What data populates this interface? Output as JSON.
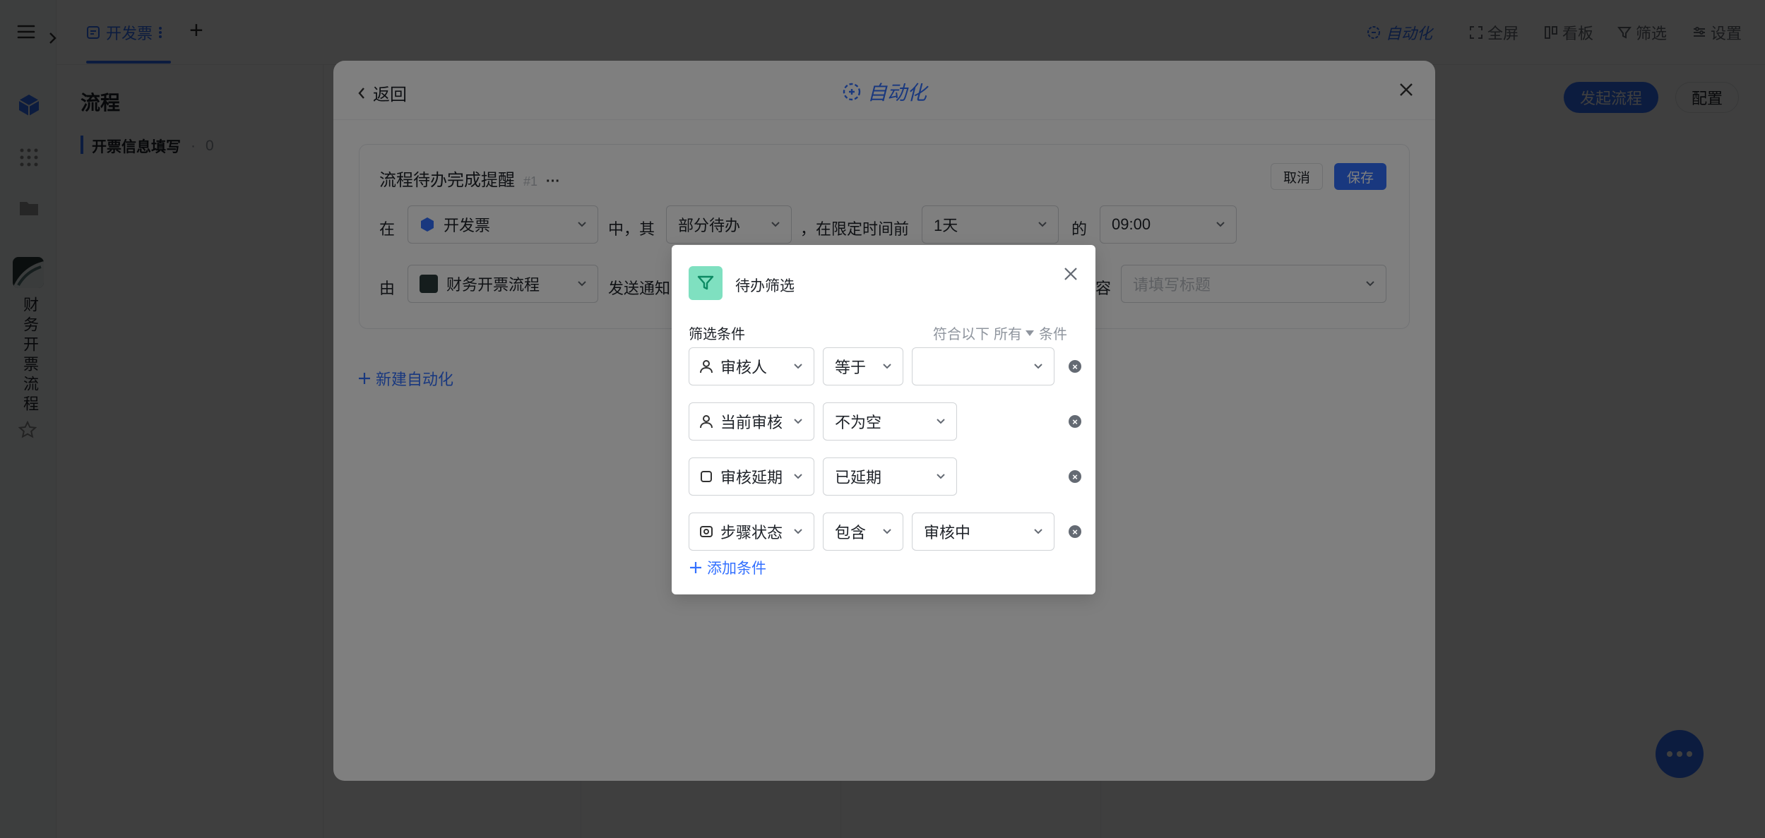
{
  "topbar": {
    "tab_label": "开发票",
    "add_tab": "+",
    "actions": {
      "automation": "自动化",
      "fullscreen": "全屏",
      "kanban": "看板",
      "filter": "筛选",
      "settings": "设置"
    }
  },
  "leftbar": {
    "app_name": "财务开票流程"
  },
  "sidepanel": {
    "title": "流程",
    "item_label": "开票信息填写",
    "item_count": "0",
    "start_button": "发起流程",
    "config_button": "配置"
  },
  "modal": {
    "back": "返回",
    "title": "自动化",
    "rule_name": "流程待办完成提醒",
    "rule_id": "#1",
    "more": "···",
    "cancel": "取消",
    "save": "保存",
    "row1": {
      "in_label": "在",
      "table_value": "开发票",
      "mid_label": "中，其",
      "todo_value": "部分待办",
      "limit_label": "，在限定时间前",
      "duration_value": "1天",
      "of_label": "的",
      "time_value": "09:00"
    },
    "row2": {
      "by_label": "由",
      "flow_value": "财务开票流程",
      "send_label": "发送通知",
      "content_label": "容",
      "title_placeholder": "请填写标题"
    },
    "new_automation": "新建自动化"
  },
  "filter_dialog": {
    "title": "待办筛选",
    "conditions_label": "筛选条件",
    "match_prefix": "符合以下",
    "match_mode": "所有",
    "match_suffix": "条件",
    "conditions": [
      {
        "field": "审核人",
        "operator": "等于",
        "value": ""
      },
      {
        "field": "当前审核",
        "operator": "不为空",
        "value": ""
      },
      {
        "field": "审核延期",
        "operator": "已延期",
        "value": ""
      },
      {
        "field": "步骤状态",
        "operator": "包含",
        "value": "审核中"
      }
    ],
    "add_condition": "添加条件"
  },
  "colors": {
    "accent": "#3370ff",
    "filter_icon_bg": "#2ecc9a"
  }
}
